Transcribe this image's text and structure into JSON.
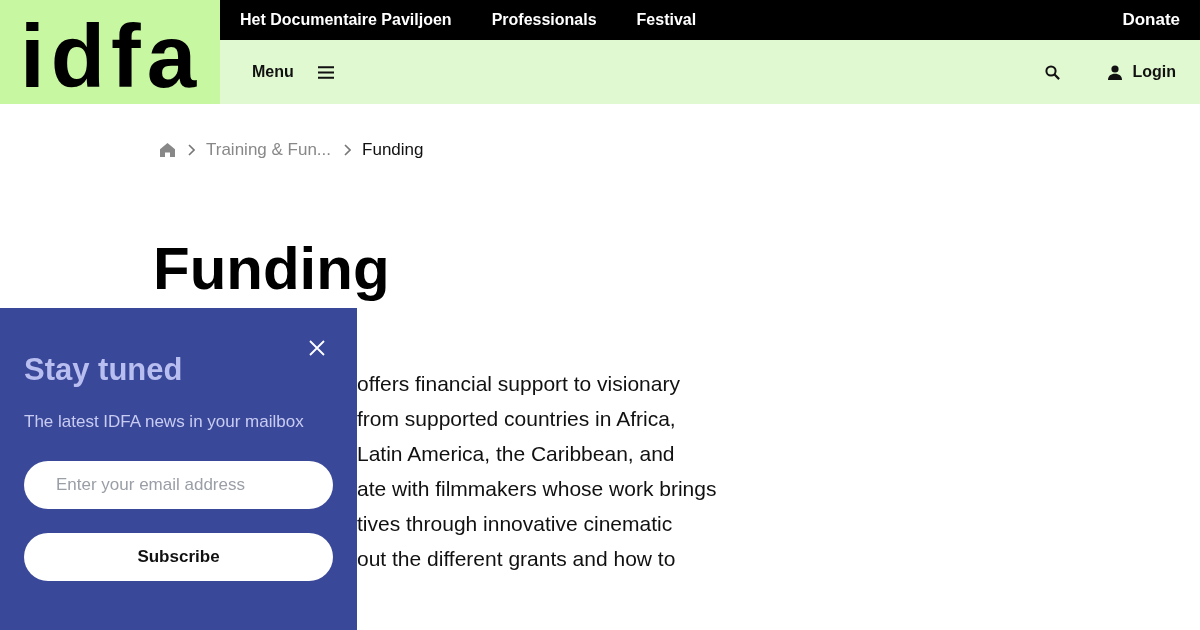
{
  "logo": {
    "text": "idfa"
  },
  "top_nav": {
    "links": [
      "Het Documentaire Paviljoen",
      "Professionals",
      "Festival"
    ],
    "donate": "Donate"
  },
  "sub_nav": {
    "menu": "Menu",
    "login": "Login"
  },
  "breadcrumb": [
    {
      "kind": "home"
    },
    {
      "kind": "link",
      "label": "Training & Fun..."
    },
    {
      "kind": "current",
      "label": "Funding"
    }
  ],
  "page_title": "Funding",
  "body_lines": [
    "offers financial support to visionary",
    "from supported countries in Africa,",
    "Latin America, the Caribbean, and",
    "ate with filmmakers whose work brings",
    "tives through innovative cinematic",
    "out the different grants and how to"
  ],
  "newsletter_popup": {
    "title": "Stay tuned",
    "subtitle": "The latest IDFA news in your mailbox",
    "email_field": {
      "placeholder": "Enter your email address"
    },
    "button": "Subscribe"
  }
}
